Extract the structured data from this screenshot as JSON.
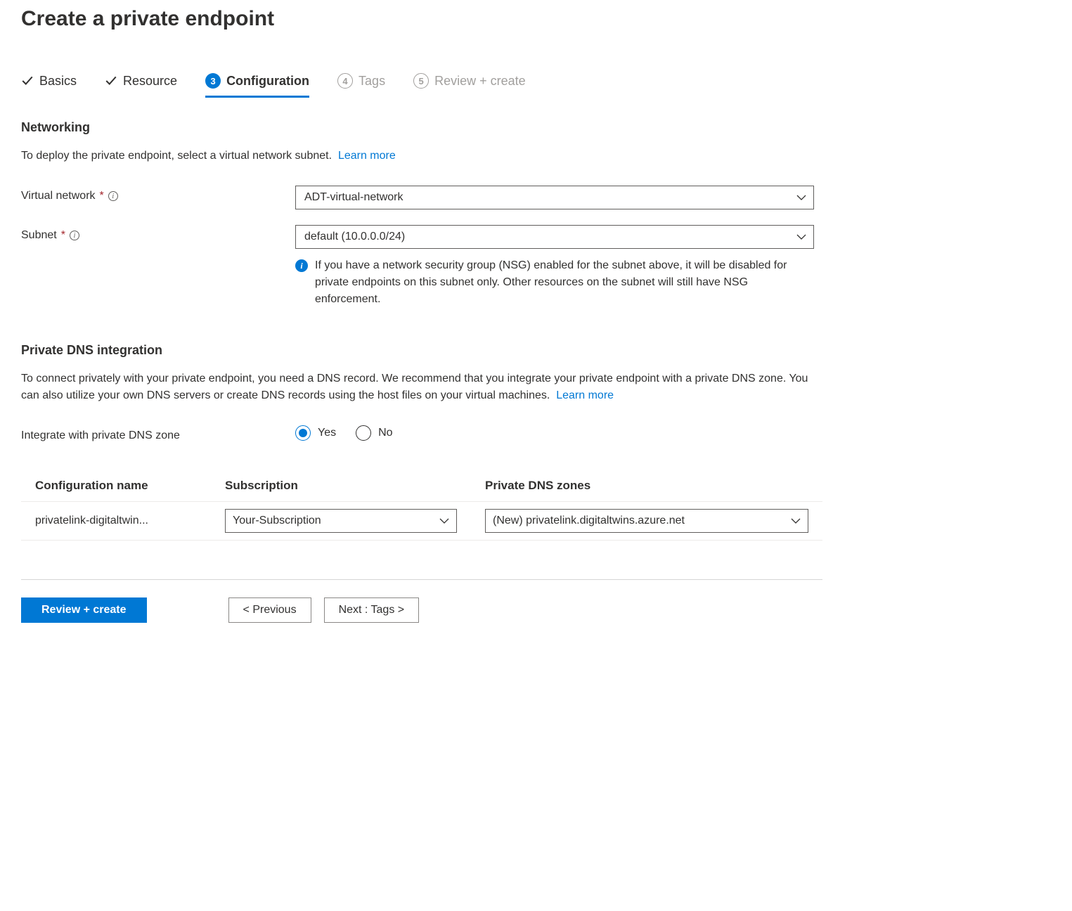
{
  "page_title": "Create a private endpoint",
  "tabs": {
    "basics": "Basics",
    "resource": "Resource",
    "configuration": {
      "num": "3",
      "label": "Configuration"
    },
    "tags": {
      "num": "4",
      "label": "Tags"
    },
    "review": {
      "num": "5",
      "label": "Review + create"
    }
  },
  "networking": {
    "heading": "Networking",
    "desc": "To deploy the private endpoint, select a virtual network subnet.",
    "learn_more": "Learn more",
    "vnet_label": "Virtual network",
    "vnet_value": "ADT-virtual-network",
    "subnet_label": "Subnet",
    "subnet_value": "default (10.0.0.0/24)",
    "nsg_note": "If you have a network security group (NSG) enabled for the subnet above, it will be disabled for private endpoints on this subnet only. Other resources on the subnet will still have NSG enforcement."
  },
  "dns": {
    "heading": "Private DNS integration",
    "desc": "To connect privately with your private endpoint, you need a DNS record. We recommend that you integrate your private endpoint with a private DNS zone. You can also utilize your own DNS servers or create DNS records using the host files on your virtual machines.",
    "learn_more": "Learn more",
    "integrate_label": "Integrate with private DNS zone",
    "radio_yes": "Yes",
    "radio_no": "No",
    "table": {
      "col_config": "Configuration name",
      "col_sub": "Subscription",
      "col_zone": "Private DNS zones",
      "row_config": "privatelink-digitaltwin...",
      "row_sub": "Your-Subscription",
      "row_zone": "(New) privatelink.digitaltwins.azure.net"
    }
  },
  "footer": {
    "review": "Review + create",
    "previous": "< Previous",
    "next": "Next : Tags >"
  }
}
